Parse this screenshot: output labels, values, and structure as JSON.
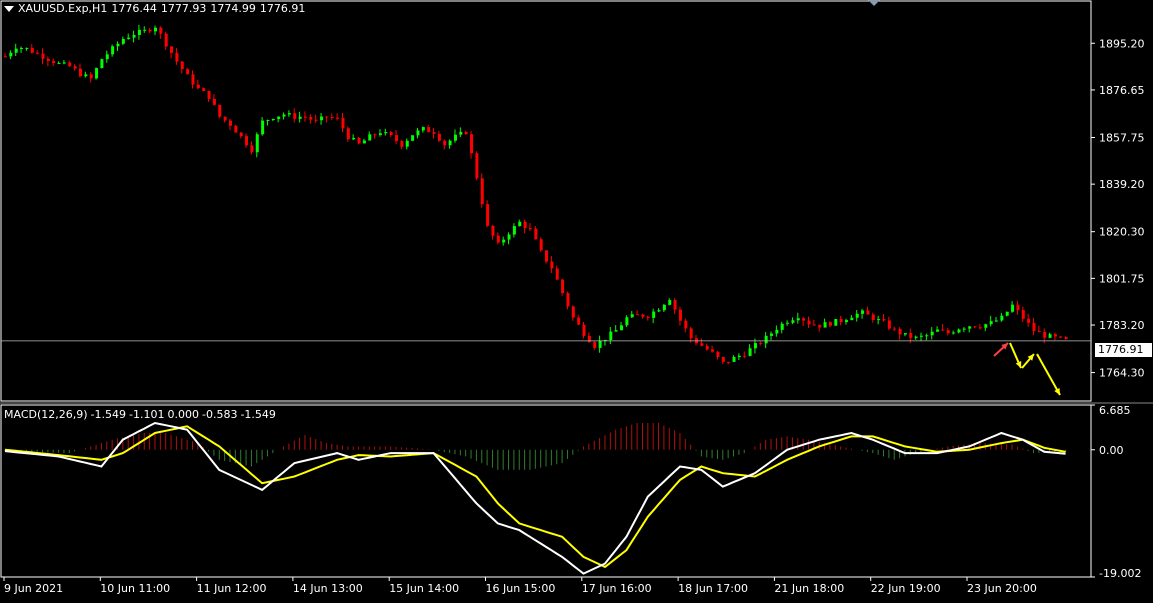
{
  "header": {
    "symbol": "XAUUSD.Exp,H1",
    "open": "1776.44",
    "high": "1777.93",
    "low": "1774.99",
    "close": "1776.91"
  },
  "macd_header": {
    "name": "MACD(12,26,9)",
    "values": [
      "-1.549",
      "-1.101",
      "0.000",
      "-0.583",
      "-1.549"
    ]
  },
  "current_price": "1776.91",
  "colors": {
    "background": "#000000",
    "bull_candle": "#00ff00",
    "bear_candle": "#ff0000",
    "macd_line": "#ffffff",
    "signal_line": "#ffff00",
    "arrows": "#ffff00",
    "grid_border": "#ffffff"
  },
  "chart_data": [
    {
      "type": "candlestick",
      "title": "XAUUSD.Exp,H1",
      "ylim": [
        1753,
        1912
      ],
      "y_ticks": [
        "1895.20",
        "1876.65",
        "1857.75",
        "1839.20",
        "1820.30",
        "1801.75",
        "1783.20",
        "1764.30"
      ],
      "x_ticks": [
        "9 Jun 2021",
        "10 Jun 11:00",
        "11 Jun 12:00",
        "14 Jun 13:00",
        "15 Jun 14:00",
        "16 Jun 15:00",
        "17 Jun 16:00",
        "18 Jun 17:00",
        "21 Jun 18:00",
        "22 Jun 19:00",
        "23 Jun 20:00"
      ],
      "close_path": [
        [
          0,
          1890
        ],
        [
          2,
          1894
        ],
        [
          4,
          1893
        ],
        [
          6,
          1891
        ],
        [
          8,
          1889
        ],
        [
          10,
          1887
        ],
        [
          12,
          1886
        ],
        [
          14,
          1883
        ],
        [
          16,
          1881
        ],
        [
          18,
          1889
        ],
        [
          20,
          1893
        ],
        [
          22,
          1897
        ],
        [
          24,
          1899
        ],
        [
          26,
          1900
        ],
        [
          28,
          1902
        ],
        [
          30,
          1895
        ],
        [
          32,
          1888
        ],
        [
          34,
          1882
        ],
        [
          36,
          1877
        ],
        [
          38,
          1874
        ],
        [
          40,
          1866
        ],
        [
          42,
          1863
        ],
        [
          44,
          1858
        ],
        [
          46,
          1853
        ],
        [
          48,
          1864
        ],
        [
          50,
          1866
        ],
        [
          52,
          1867
        ],
        [
          54,
          1866
        ],
        [
          56,
          1866
        ],
        [
          58,
          1864
        ],
        [
          60,
          1866
        ],
        [
          62,
          1865
        ],
        [
          64,
          1858
        ],
        [
          66,
          1855
        ],
        [
          68,
          1858
        ],
        [
          70,
          1860
        ],
        [
          72,
          1858
        ],
        [
          74,
          1855
        ],
        [
          76,
          1859
        ],
        [
          78,
          1861
        ],
        [
          80,
          1860
        ],
        [
          82,
          1855
        ],
        [
          84,
          1858
        ],
        [
          86,
          1860
        ],
        [
          88,
          1842
        ],
        [
          90,
          1822
        ],
        [
          92,
          1815
        ],
        [
          94,
          1820
        ],
        [
          96,
          1824
        ],
        [
          98,
          1821
        ],
        [
          100,
          1812
        ],
        [
          102,
          1806
        ],
        [
          104,
          1796
        ],
        [
          106,
          1786
        ],
        [
          108,
          1780
        ],
        [
          110,
          1775
        ],
        [
          112,
          1778
        ],
        [
          114,
          1781
        ],
        [
          116,
          1786
        ],
        [
          118,
          1787
        ],
        [
          120,
          1787
        ],
        [
          122,
          1790
        ],
        [
          124,
          1794
        ],
        [
          126,
          1785
        ],
        [
          128,
          1778
        ],
        [
          130,
          1775
        ],
        [
          132,
          1772
        ],
        [
          134,
          1768
        ],
        [
          136,
          1770
        ],
        [
          138,
          1772
        ],
        [
          140,
          1775
        ],
        [
          142,
          1778
        ],
        [
          144,
          1782
        ],
        [
          146,
          1785
        ],
        [
          148,
          1787
        ],
        [
          150,
          1784
        ],
        [
          152,
          1783
        ],
        [
          154,
          1784
        ],
        [
          156,
          1785
        ],
        [
          158,
          1787
        ],
        [
          160,
          1788
        ],
        [
          162,
          1786
        ],
        [
          164,
          1784
        ],
        [
          166,
          1781
        ],
        [
          168,
          1779
        ],
        [
          170,
          1778
        ],
        [
          172,
          1779
        ],
        [
          174,
          1781
        ],
        [
          176,
          1780
        ],
        [
          178,
          1782
        ],
        [
          180,
          1783
        ],
        [
          182,
          1783
        ],
        [
          184,
          1784
        ],
        [
          186,
          1786
        ],
        [
          188,
          1791
        ],
        [
          190,
          1786
        ],
        [
          192,
          1781
        ],
        [
          194,
          1779
        ],
        [
          196,
          1778
        ],
        [
          198,
          1777
        ]
      ],
      "current_line": 1776.91
    },
    {
      "type": "macd",
      "title": "MACD(12,26,9)",
      "ylim": [
        -19.002,
        6.685
      ],
      "y_ticks": [
        "6.685",
        "0.00",
        "-19.002"
      ],
      "macd_line": [
        [
          0,
          -0.2
        ],
        [
          10,
          -1.0
        ],
        [
          18,
          -2.5
        ],
        [
          22,
          1.5
        ],
        [
          28,
          4.0
        ],
        [
          34,
          3.0
        ],
        [
          40,
          -3.0
        ],
        [
          48,
          -6.0
        ],
        [
          54,
          -2.0
        ],
        [
          62,
          -0.5
        ],
        [
          66,
          -1.5
        ],
        [
          72,
          -0.5
        ],
        [
          80,
          -0.5
        ],
        [
          88,
          -8.0
        ],
        [
          92,
          -11.0
        ],
        [
          96,
          -12.0
        ],
        [
          100,
          -14.0
        ],
        [
          104,
          -16.0
        ],
        [
          108,
          -18.5
        ],
        [
          112,
          -17.0
        ],
        [
          116,
          -13.0
        ],
        [
          120,
          -7.0
        ],
        [
          126,
          -2.5
        ],
        [
          130,
          -3.0
        ],
        [
          134,
          -5.5
        ],
        [
          140,
          -3.5
        ],
        [
          146,
          0.0
        ],
        [
          152,
          1.5
        ],
        [
          158,
          2.5
        ],
        [
          162,
          1.5
        ],
        [
          168,
          -0.5
        ],
        [
          174,
          -0.5
        ],
        [
          180,
          0.5
        ],
        [
          186,
          2.5
        ],
        [
          190,
          1.5
        ],
        [
          194,
          -0.3
        ],
        [
          198,
          -0.6
        ]
      ],
      "signal_line": [
        [
          0,
          0.0
        ],
        [
          10,
          -0.8
        ],
        [
          18,
          -1.5
        ],
        [
          22,
          -0.5
        ],
        [
          28,
          2.5
        ],
        [
          34,
          3.5
        ],
        [
          40,
          0.5
        ],
        [
          48,
          -5.0
        ],
        [
          54,
          -4.0
        ],
        [
          62,
          -1.5
        ],
        [
          66,
          -0.8
        ],
        [
          72,
          -1.0
        ],
        [
          80,
          -0.5
        ],
        [
          88,
          -4.0
        ],
        [
          92,
          -8.0
        ],
        [
          96,
          -11.0
        ],
        [
          100,
          -12.0
        ],
        [
          104,
          -13.0
        ],
        [
          108,
          -16.0
        ],
        [
          112,
          -17.5
        ],
        [
          116,
          -15.0
        ],
        [
          120,
          -10.0
        ],
        [
          126,
          -4.5
        ],
        [
          130,
          -2.5
        ],
        [
          134,
          -3.5
        ],
        [
          140,
          -4.0
        ],
        [
          146,
          -1.5
        ],
        [
          152,
          0.5
        ],
        [
          158,
          2.0
        ],
        [
          162,
          2.0
        ],
        [
          168,
          0.5
        ],
        [
          174,
          -0.3
        ],
        [
          180,
          0.0
        ],
        [
          186,
          1.0
        ],
        [
          190,
          1.5
        ],
        [
          194,
          0.3
        ],
        [
          198,
          -0.3
        ]
      ],
      "histogram_shape": [
        [
          0,
          -0.2
        ],
        [
          12,
          -0.5
        ],
        [
          16,
          0.5
        ],
        [
          20,
          1.5
        ],
        [
          26,
          2.5
        ],
        [
          30,
          2.5
        ],
        [
          36,
          1.0
        ],
        [
          40,
          -1.5
        ],
        [
          46,
          -2.5
        ],
        [
          52,
          0.5
        ],
        [
          56,
          2.2
        ],
        [
          60,
          1.0
        ],
        [
          64,
          0.5
        ],
        [
          72,
          0.5
        ],
        [
          80,
          0.0
        ],
        [
          86,
          -1.0
        ],
        [
          92,
          -3.0
        ],
        [
          98,
          -3.0
        ],
        [
          104,
          -2.0
        ],
        [
          108,
          0.5
        ],
        [
          114,
          3.0
        ],
        [
          118,
          4.0
        ],
        [
          122,
          4.0
        ],
        [
          126,
          2.5
        ],
        [
          130,
          -1.0
        ],
        [
          134,
          -1.5
        ],
        [
          138,
          -0.5
        ],
        [
          142,
          1.5
        ],
        [
          146,
          2.0
        ],
        [
          150,
          1.5
        ],
        [
          156,
          0.5
        ],
        [
          162,
          -0.5
        ],
        [
          166,
          -1.5
        ],
        [
          170,
          -0.5
        ],
        [
          176,
          0.5
        ],
        [
          182,
          1.0
        ],
        [
          188,
          0.8
        ],
        [
          192,
          -0.5
        ],
        [
          198,
          -0.3
        ]
      ]
    }
  ]
}
